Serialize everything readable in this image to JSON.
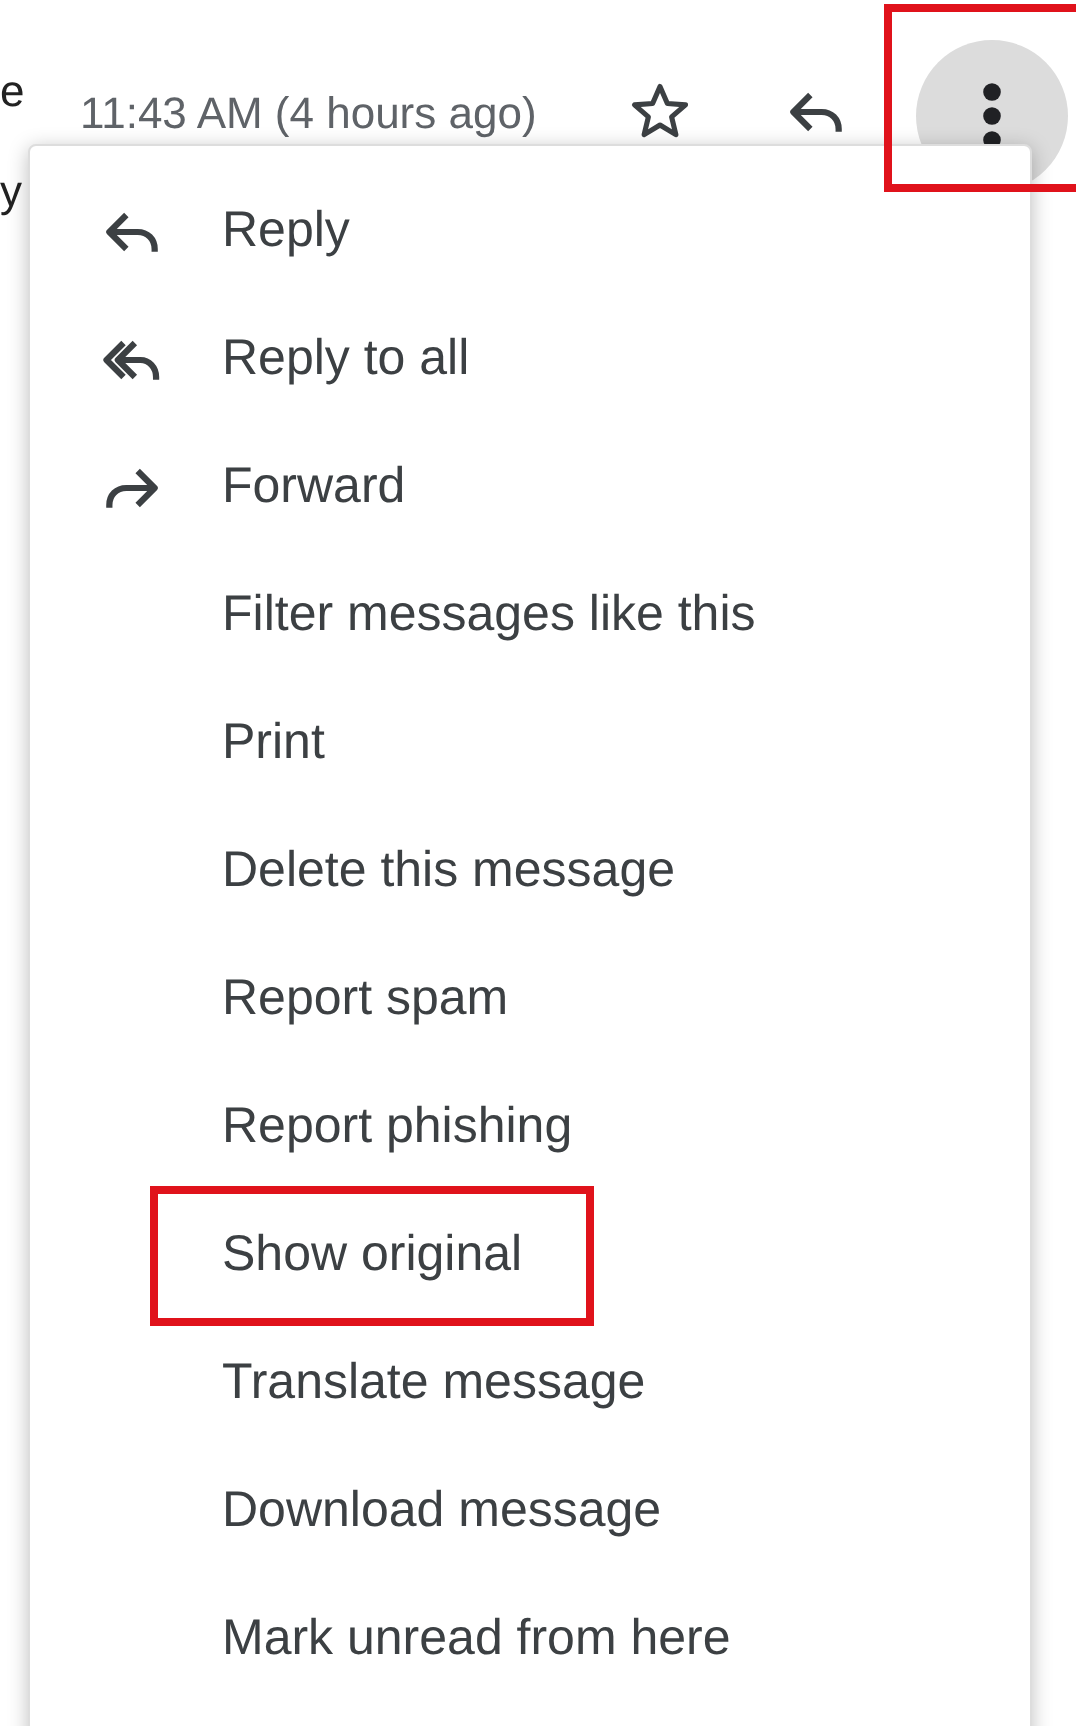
{
  "background_text": [
    "e",
    "y"
  ],
  "header": {
    "timestamp": "11:43 AM (4 hours ago)",
    "more_button_highlighted": true
  },
  "menu": {
    "items": [
      {
        "label": "Reply",
        "kind": "reply",
        "highlighted": false
      },
      {
        "label": "Reply to all",
        "kind": "replyall",
        "highlighted": false
      },
      {
        "label": "Forward",
        "kind": "forward",
        "highlighted": false
      },
      {
        "label": "Filter messages like this",
        "kind": "plain",
        "highlighted": false
      },
      {
        "label": "Print",
        "kind": "plain",
        "highlighted": false
      },
      {
        "label": "Delete this message",
        "kind": "plain",
        "highlighted": false
      },
      {
        "label": "Report spam",
        "kind": "plain",
        "highlighted": false
      },
      {
        "label": "Report phishing",
        "kind": "plain",
        "highlighted": false
      },
      {
        "label": "Show original",
        "kind": "plain",
        "highlighted": true
      },
      {
        "label": "Translate message",
        "kind": "plain",
        "highlighted": false
      },
      {
        "label": "Download message",
        "kind": "plain",
        "highlighted": false
      },
      {
        "label": "Mark unread from here",
        "kind": "plain",
        "highlighted": false
      }
    ]
  }
}
